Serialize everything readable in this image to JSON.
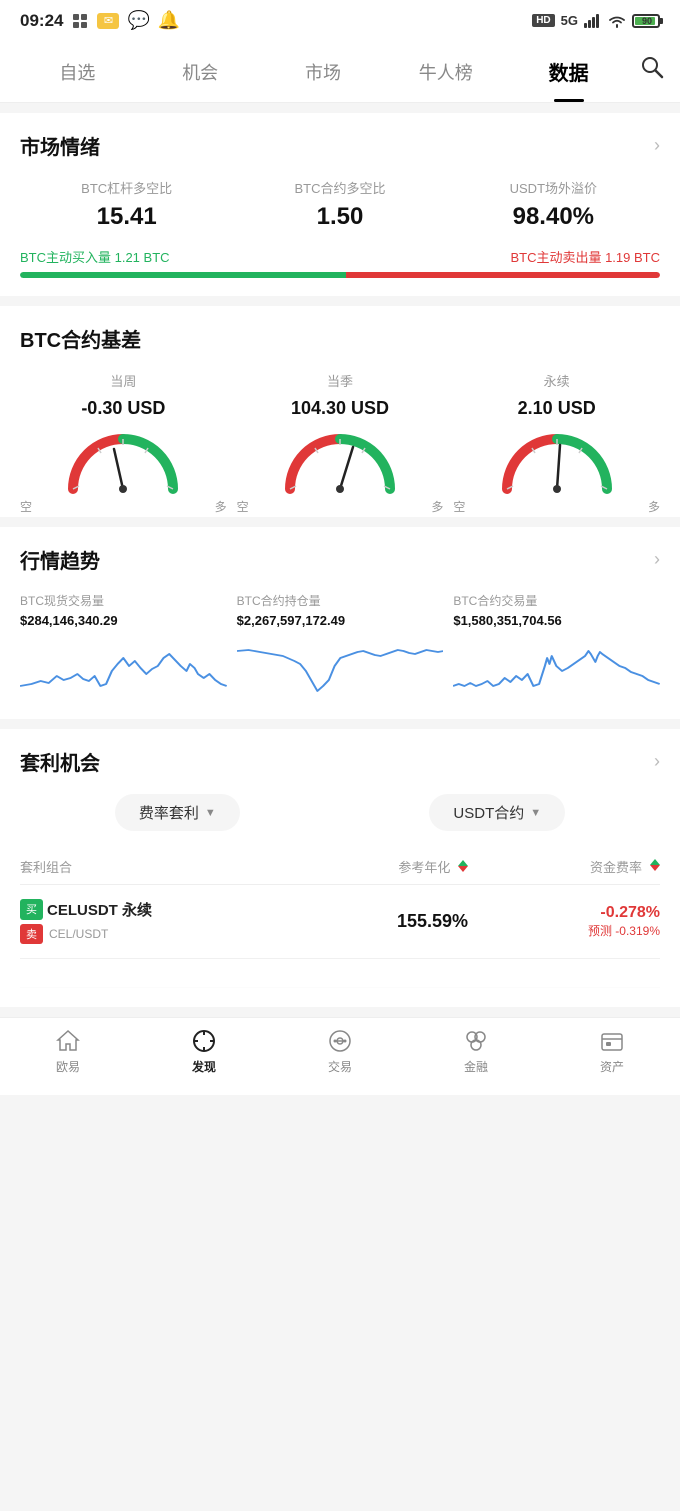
{
  "statusBar": {
    "time": "09:24",
    "hd": "HD",
    "signal5g": "5G",
    "battery": "90"
  },
  "navTabs": {
    "items": [
      "自选",
      "机会",
      "市场",
      "牛人榜",
      "数据"
    ],
    "activeIndex": 4
  },
  "marketSentiment": {
    "title": "市场情绪",
    "columns": [
      {
        "label": "BTC杠杆多空比",
        "value": "15.41"
      },
      {
        "label": "BTC合约多空比",
        "value": "1.50"
      },
      {
        "label": "USDT场外溢价",
        "value": "98.40%"
      }
    ],
    "buyLabel": "BTC主动买入量 1.21 BTC",
    "sellLabel": "BTC主动卖出量 1.19 BTC",
    "buyPercent": 51
  },
  "contractBasis": {
    "title": "BTC合约基差",
    "columns": [
      {
        "label": "当周",
        "value": "-0.30 USD",
        "needleAngle": -10
      },
      {
        "label": "当季",
        "value": "104.30 USD",
        "needleAngle": 25
      },
      {
        "label": "永续",
        "value": "2.10 USD",
        "needleAngle": 5
      }
    ]
  },
  "marketTrend": {
    "title": "行情趋势",
    "columns": [
      {
        "label": "BTC现货交易量",
        "value": "$284,146,340.29"
      },
      {
        "label": "BTC合约持仓量",
        "value": "$2,267,597,172.49"
      },
      {
        "label": "BTC合约交易量",
        "value": "$1,580,351,704.56"
      }
    ]
  },
  "arbitrage": {
    "title": "套利机会",
    "filter1": "费率套利",
    "filter2": "USDT合约",
    "tableHeaders": {
      "combo": "套利组合",
      "annualized": "参考年化",
      "fundRate": "资金费率"
    },
    "rows": [
      {
        "buyBadge": "买",
        "sellBadge": "卖",
        "pair": "CELUSDT 永续",
        "sub": "CEL/USDT",
        "annualized": "155.59%",
        "fundRate": "-0.278%",
        "fundPredict": "预测 -0.319%"
      }
    ]
  },
  "bottomNav": {
    "items": [
      {
        "label": "欧易",
        "icon": "home"
      },
      {
        "label": "发现",
        "icon": "discover",
        "active": true
      },
      {
        "label": "交易",
        "icon": "trade"
      },
      {
        "label": "金融",
        "icon": "finance"
      },
      {
        "label": "资产",
        "icon": "assets"
      }
    ]
  }
}
